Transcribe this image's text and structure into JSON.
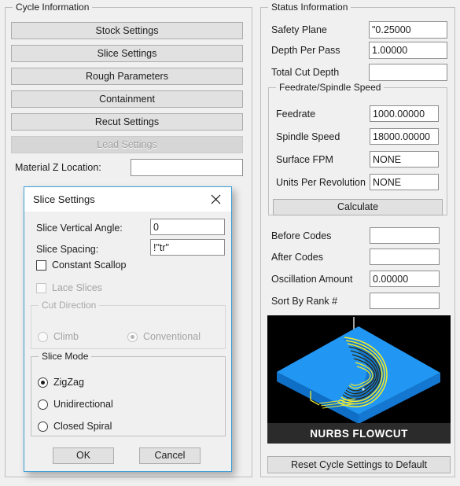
{
  "cycle_panel": {
    "title": "Cycle Information",
    "buttons": [
      {
        "label": "Stock Settings",
        "disabled": false
      },
      {
        "label": "Slice Settings",
        "disabled": false
      },
      {
        "label": "Rough Parameters",
        "disabled": false
      },
      {
        "label": "Containment",
        "disabled": false
      },
      {
        "label": "Recut Settings",
        "disabled": false
      },
      {
        "label": "Lead Settings",
        "disabled": true
      }
    ],
    "material_z_label": "Material Z Location:",
    "material_z_value": ""
  },
  "status_panel": {
    "title": "Status Information",
    "rows": [
      {
        "label": "Safety Plane",
        "value": "\"0.25000"
      },
      {
        "label": "Depth Per Pass",
        "value": "1.00000"
      },
      {
        "label": "Total Cut Depth",
        "value": ""
      }
    ],
    "feedrate_group": {
      "title": "Feedrate/Spindle Speed",
      "rows": [
        {
          "label": "Feedrate",
          "value": "1000.00000"
        },
        {
          "label": "Spindle Speed",
          "value": "18000.00000"
        },
        {
          "label": "Surface FPM",
          "value": "NONE"
        },
        {
          "label": "Units Per Revolution",
          "value": "NONE"
        }
      ],
      "calculate_label": "Calculate"
    },
    "lower_rows": [
      {
        "label": "Before Codes",
        "value": ""
      },
      {
        "label": "After Codes",
        "value": ""
      },
      {
        "label": "Oscillation Amount",
        "value": "0.00000"
      },
      {
        "label": "Sort By Rank #",
        "value": ""
      }
    ],
    "preview_caption": "NURBS FLOWCUT",
    "reset_label": "Reset Cycle Settings to Default"
  },
  "dialog": {
    "title": "Slice Settings",
    "close_icon": "close-icon",
    "vertical_angle_label": "Slice Vertical Angle:",
    "vertical_angle_value": "0",
    "spacing_label": "Slice Spacing:",
    "spacing_value": "!\"tr\"",
    "constant_scallop_label": "Constant Scallop",
    "constant_scallop_checked": false,
    "lace_slices_label": "Lace Slices",
    "lace_slices_checked": false,
    "lace_slices_disabled": true,
    "cut_direction": {
      "title": "Cut Direction",
      "disabled": true,
      "options": [
        {
          "label": "Climb",
          "selected": false
        },
        {
          "label": "Conventional",
          "selected": true
        }
      ]
    },
    "slice_mode": {
      "title": "Slice Mode",
      "options": [
        {
          "label": "ZigZag",
          "selected": true
        },
        {
          "label": "Unidirectional",
          "selected": false
        },
        {
          "label": "Closed Spiral",
          "selected": false
        }
      ]
    },
    "ok_label": "OK",
    "cancel_label": "Cancel"
  },
  "colors": {
    "window_bg": "#f0f0f0",
    "button_face": "#e1e1e1",
    "accent_border": "#3a9fd6",
    "preview_bg": "#000000",
    "preview_blue": "#2196f3",
    "preview_yellow": "#f2ec2a"
  }
}
